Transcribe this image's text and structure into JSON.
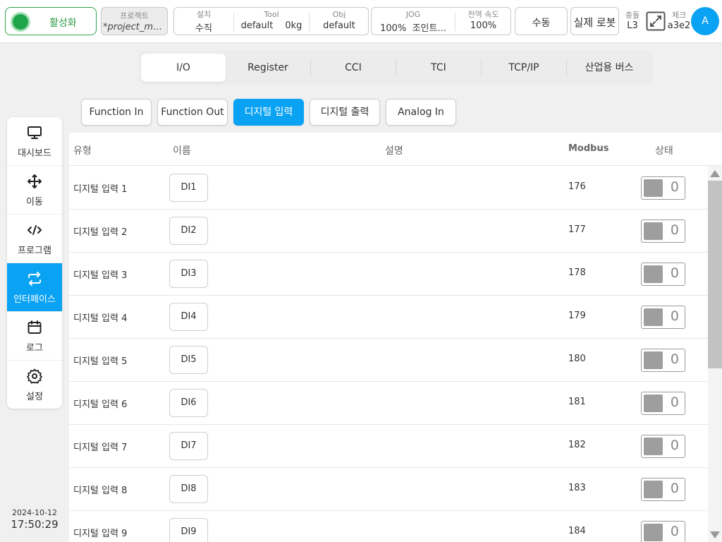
{
  "topbar": {
    "activate_label": "활성화",
    "project": {
      "title": "프로젝트",
      "value": "*project_mo..."
    },
    "install": {
      "title": "설치",
      "value": "수직"
    },
    "tool": {
      "title": "Tool",
      "value": "default",
      "weight": "0kg"
    },
    "obj": {
      "title": "Obj",
      "value": "default"
    },
    "jog": {
      "title": "JOG",
      "percent": "100%",
      "mode": "조인트..."
    },
    "global_speed": {
      "title": "전역 속도",
      "value": "100%"
    },
    "manual_label": "수동",
    "real_robot_label": "실제 로봇",
    "collision": {
      "title": "충돌",
      "value": "L3"
    },
    "check": {
      "title": "체크",
      "value": "a3e2"
    },
    "avatar_letter": "A"
  },
  "sidebar": {
    "items": [
      {
        "label": "대시보드",
        "icon": "monitor-icon"
      },
      {
        "label": "이동",
        "icon": "move-icon"
      },
      {
        "label": "프로그램",
        "icon": "code-icon"
      },
      {
        "label": "인터페이스",
        "icon": "swap-icon",
        "active": true
      },
      {
        "label": "로그",
        "icon": "calendar-icon"
      },
      {
        "label": "설정",
        "icon": "gear-icon"
      }
    ],
    "date": "2024-10-12",
    "time": "17:50:29"
  },
  "tabs": [
    "I/O",
    "Register",
    "CCI",
    "TCI",
    "TCP/IP",
    "산업용 버스"
  ],
  "active_tab": "I/O",
  "subtabs": [
    "Function In",
    "Function Out",
    "디지털 입력",
    "디지털 출력",
    "Analog In"
  ],
  "active_subtab": "디지털 입력",
  "table": {
    "headers": {
      "type": "유형",
      "name": "이름",
      "desc": "설명",
      "modbus": "Modbus",
      "state": "상태"
    },
    "rows": [
      {
        "type": "디지털 입력 1",
        "name": "DI1",
        "modbus": "176",
        "state": "0"
      },
      {
        "type": "디지털 입력 2",
        "name": "DI2",
        "modbus": "177",
        "state": "0"
      },
      {
        "type": "디지털 입력 3",
        "name": "DI3",
        "modbus": "178",
        "state": "0"
      },
      {
        "type": "디지털 입력 4",
        "name": "DI4",
        "modbus": "179",
        "state": "0"
      },
      {
        "type": "디지털 입력 5",
        "name": "DI5",
        "modbus": "180",
        "state": "0"
      },
      {
        "type": "디지털 입력 6",
        "name": "DI6",
        "modbus": "181",
        "state": "0"
      },
      {
        "type": "디지털 입력 7",
        "name": "DI7",
        "modbus": "182",
        "state": "0"
      },
      {
        "type": "디지털 입력 8",
        "name": "DI8",
        "modbus": "183",
        "state": "0"
      },
      {
        "type": "디지털 입력 9",
        "name": "DI9",
        "modbus": "184",
        "state": "0"
      }
    ]
  },
  "colors": {
    "accent": "#0aa2f2",
    "active_green": "#1ea54a"
  }
}
